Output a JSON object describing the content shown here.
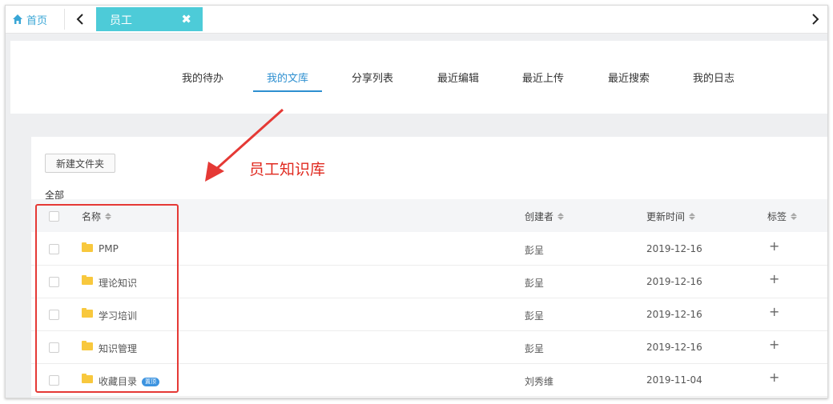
{
  "tabbar": {
    "home_label": "首页",
    "active_tab_label": "员工",
    "close_symbol": "✖"
  },
  "nav": {
    "tabs": [
      "我的待办",
      "我的文库",
      "分享列表",
      "最近编辑",
      "最近上传",
      "最近搜索",
      "我的日志"
    ],
    "active_index": 1
  },
  "toolbar": {
    "new_folder_label": "新建文件夹"
  },
  "breadcrumb": "全部",
  "table": {
    "headers": {
      "name": "名称",
      "creator": "创建者",
      "updated": "更新时间",
      "tags": "标签"
    },
    "rows": [
      {
        "name": "PMP",
        "creator": "彭呈",
        "updated": "2019-12-16",
        "tag_action": "+"
      },
      {
        "name": "理论知识",
        "creator": "彭呈",
        "updated": "2019-12-16",
        "tag_action": "+"
      },
      {
        "name": "学习培训",
        "creator": "彭呈",
        "updated": "2019-12-16",
        "tag_action": "+"
      },
      {
        "name": "知识管理",
        "creator": "彭呈",
        "updated": "2019-12-16",
        "tag_action": "+"
      },
      {
        "name": "收藏目录",
        "badge": "置顶",
        "creator": "刘秀维",
        "updated": "2019-11-04",
        "tag_action": "+"
      }
    ]
  },
  "annotation": {
    "text": "员工知识库"
  },
  "colors": {
    "accent": "#2d8fd0",
    "tab_active_bg": "#4dcbd8",
    "annotation": "#e53935",
    "folder": "#f8c83d"
  }
}
